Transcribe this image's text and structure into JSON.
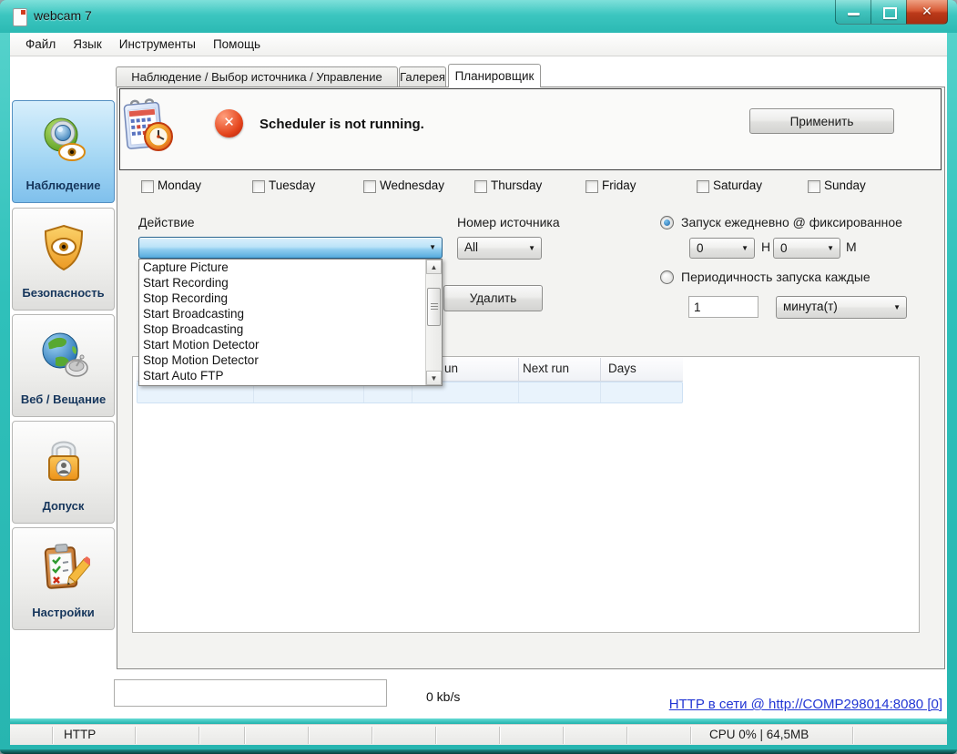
{
  "title_bar": {
    "title": "webcam 7"
  },
  "menu_bar": {
    "items": [
      "Файл",
      "Язык",
      "Инструменты",
      "Помощь"
    ]
  },
  "tab_bar": {
    "tabs": [
      {
        "label": "Наблюдение / Выбор источника / Управление"
      },
      {
        "label": "Галерея"
      },
      {
        "label": "Планировщик"
      }
    ],
    "active_tab": "Планировщик"
  },
  "sidebar": {
    "items": [
      {
        "label": "Наблюдение",
        "icon": "webcam-eye-icon"
      },
      {
        "label": "Безопасность",
        "icon": "shield-eye-icon"
      },
      {
        "label": "Веб / Вещание",
        "icon": "globe-satellite-icon"
      },
      {
        "label": "Допуск",
        "icon": "padlock-user-icon"
      },
      {
        "label": "Настройки",
        "icon": "clipboard-pencil-icon"
      }
    ],
    "active_item": "Наблюдение"
  },
  "scheduler": {
    "status_message": "Scheduler is not running.",
    "apply_button": "Применить",
    "days": [
      "Monday",
      "Tuesday",
      "Wednesday",
      "Thursday",
      "Friday",
      "Saturday",
      "Sunday"
    ],
    "action_label": "Действие",
    "action_selected": "",
    "action_options": [
      "Capture Picture",
      "Start Recording",
      "Stop Recording",
      "Start Broadcasting",
      "Stop Broadcasting",
      "Start Motion Detector",
      "Stop Motion Detector",
      "Start Auto FTP"
    ],
    "source_label": "Номер источника",
    "source_value": "All",
    "delete_button": "Удалить",
    "daily_option": {
      "label": "Запуск ежедневно @ фиксированное",
      "selected": true,
      "hour": "0",
      "hour_unit": "H",
      "minute": "0",
      "minute_unit": "M"
    },
    "interval_option": {
      "label": "Периодичность запуска каждые",
      "selected": false,
      "value": "1",
      "unit": "минута(т)"
    },
    "jobs_table": {
      "visible_columns": [
        "un",
        "Next run",
        "Days"
      ],
      "rows": []
    }
  },
  "footer": {
    "bandwidth": "0 kb/s",
    "http_link": "HTTP в сети @ http://COMP298014:8080 [0]"
  },
  "status_bar": {
    "protocol": "HTTP",
    "cpu_memory": "CPU 0% | 64,5MB"
  },
  "icons": {
    "cross": "✕",
    "close_x": "✕",
    "dropdown_arrow": "▼",
    "scroll_up": "▲",
    "scroll_down": "▼"
  },
  "colors": {
    "titlebar_teal": "#35c4be",
    "focused_combo_blue": "#56abdd",
    "error_red": "#d93a1e",
    "link_blue": "#2236d4",
    "active_sidebar_blue": "#7fc0ec"
  }
}
